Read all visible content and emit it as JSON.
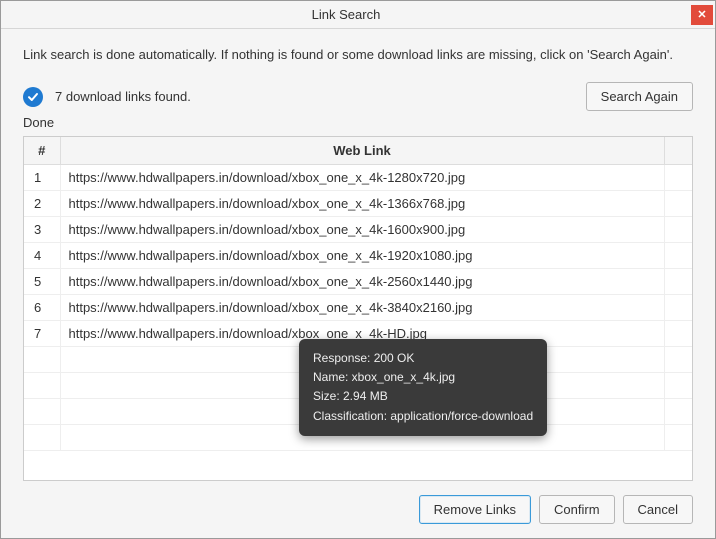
{
  "window": {
    "title": "Link Search"
  },
  "instruction": "Link search is done automatically. If nothing is found or some download links are missing, click on 'Search Again'.",
  "status": {
    "text": "7 download links found.",
    "done_label": "Done"
  },
  "buttons": {
    "search_again": "Search Again",
    "remove_links": "Remove Links",
    "confirm": "Confirm",
    "cancel": "Cancel"
  },
  "table": {
    "headers": {
      "num": "#",
      "link": "Web Link"
    },
    "rows": [
      {
        "n": "1",
        "url": "https://www.hdwallpapers.in/download/xbox_one_x_4k-1280x720.jpg"
      },
      {
        "n": "2",
        "url": "https://www.hdwallpapers.in/download/xbox_one_x_4k-1366x768.jpg"
      },
      {
        "n": "3",
        "url": "https://www.hdwallpapers.in/download/xbox_one_x_4k-1600x900.jpg"
      },
      {
        "n": "4",
        "url": "https://www.hdwallpapers.in/download/xbox_one_x_4k-1920x1080.jpg"
      },
      {
        "n": "5",
        "url": "https://www.hdwallpapers.in/download/xbox_one_x_4k-2560x1440.jpg"
      },
      {
        "n": "6",
        "url": "https://www.hdwallpapers.in/download/xbox_one_x_4k-3840x2160.jpg"
      },
      {
        "n": "7",
        "url": "https://www.hdwallpapers.in/download/xbox_one_x_4k-HD.jpg"
      }
    ]
  },
  "tooltip": {
    "line1": "Response: 200 OK",
    "line2": "Name: xbox_one_x_4k.jpg",
    "line3": "Size: 2.94 MB",
    "line4": "Classification: application/force-download"
  }
}
